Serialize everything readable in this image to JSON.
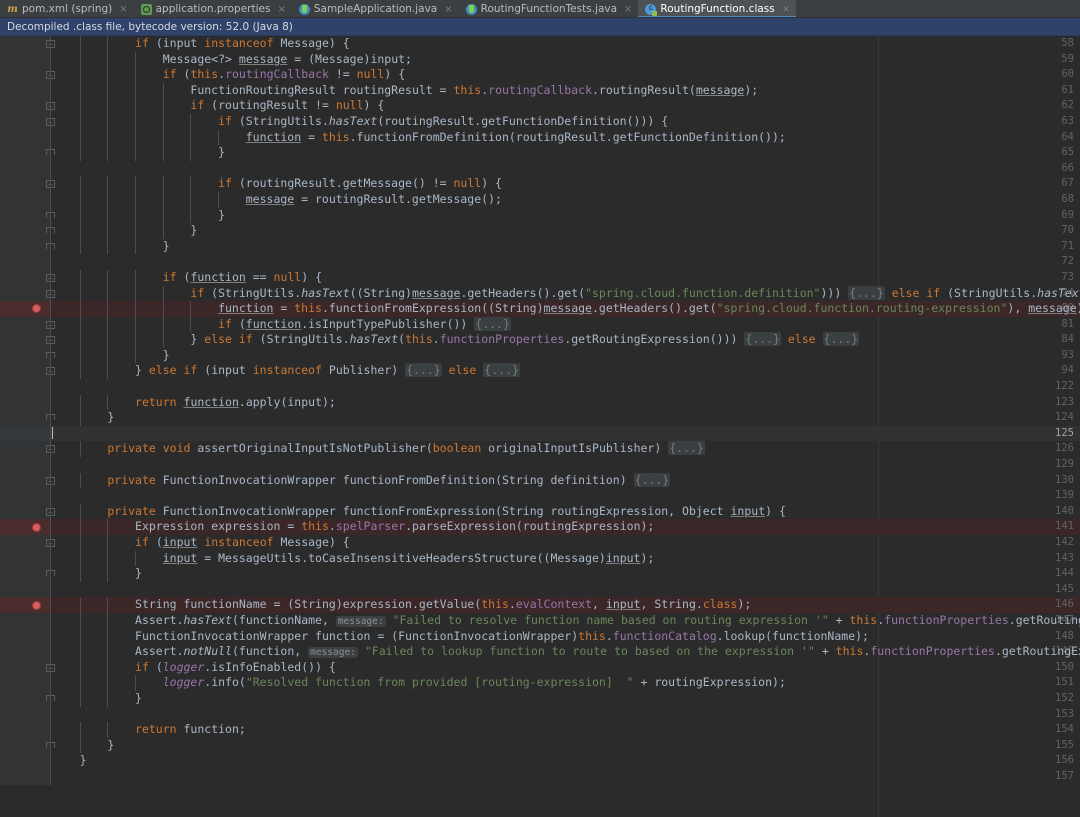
{
  "tabs": [
    {
      "label": "pom.xml (spring)",
      "icon": "maven-icon",
      "active": false,
      "close": "×"
    },
    {
      "label": "application.properties",
      "icon": "properties-icon",
      "active": false,
      "close": "×"
    },
    {
      "label": "SampleApplication.java",
      "icon": "java-class-icon",
      "active": false,
      "close": "×"
    },
    {
      "label": "RoutingFunctionTests.java",
      "icon": "java-class-icon",
      "active": false,
      "close": "×"
    },
    {
      "label": "RoutingFunction.class",
      "icon": "compiled-class-icon",
      "active": true,
      "close": "×"
    }
  ],
  "banner": {
    "text": "Decompiled .class file, bytecode version: 52.0 (Java 8)"
  },
  "colors": {
    "editor_background": "#2b2b2b",
    "gutter_background": "#313335",
    "banner_background": "#2f436a",
    "tab_active_background": "#4e5254",
    "tab_active_underline": "#4a88c7",
    "breakpoint_red": "#db5c5c",
    "breakpoint_line_background": "#3b2727",
    "caret_line_background": "#323232",
    "keyword": "#cc7832",
    "field": "#9876aa",
    "string": "#6a8759",
    "number": "#6897bb",
    "default_text": "#a9b7c6",
    "line_number": "#606366"
  },
  "editor": {
    "file_name": "RoutingFunction.class",
    "right_margin_guide_x": 878,
    "lines": [
      {
        "num": "58",
        "fold": "minus",
        "breakpoint": false,
        "caret": false,
        "indent": 3,
        "clipped_top": true,
        "html": "<span class=\"kw\">if</span> (input <span class=\"kw\">instanceof</span> Message) {"
      },
      {
        "num": "59",
        "fold": "",
        "breakpoint": false,
        "caret": false,
        "indent": 4,
        "html": "Message&lt;?&gt; <span class=\"var\">message</span> = (Message)input;"
      },
      {
        "num": "60",
        "fold": "minus",
        "breakpoint": false,
        "caret": false,
        "indent": 4,
        "html": "<span class=\"kw\">if</span> (<span class=\"kw\">this</span>.<span class=\"fld\">routingCallback</span> != <span class=\"kw\">null</span>) {"
      },
      {
        "num": "61",
        "fold": "",
        "breakpoint": false,
        "caret": false,
        "indent": 5,
        "html": "FunctionRoutingResult routingResult = <span class=\"kw\">this</span>.<span class=\"fld\">routingCallback</span>.routingResult(<span class=\"var\">message</span>);"
      },
      {
        "num": "62",
        "fold": "minus",
        "breakpoint": false,
        "caret": false,
        "indent": 5,
        "html": "<span class=\"kw\">if</span> (routingResult != <span class=\"kw\">null</span>) {"
      },
      {
        "num": "63",
        "fold": "minus",
        "breakpoint": false,
        "caret": false,
        "indent": 6,
        "html": "<span class=\"kw\">if</span> (StringUtils.<span class=\"stat\">hasText</span>(routingResult.getFunctionDefinition())) {"
      },
      {
        "num": "64",
        "fold": "",
        "breakpoint": false,
        "caret": false,
        "indent": 7,
        "html": "<span class=\"var\">function</span> = <span class=\"kw\">this</span>.functionFromDefinition(routingResult.getFunctionDefinition());"
      },
      {
        "num": "65",
        "fold": "endb",
        "breakpoint": false,
        "caret": false,
        "indent": 6,
        "html": "}"
      },
      {
        "num": "66",
        "fold": "",
        "breakpoint": false,
        "caret": false,
        "indent": 0,
        "html": ""
      },
      {
        "num": "67",
        "fold": "minus",
        "breakpoint": false,
        "caret": false,
        "indent": 6,
        "html": "<span class=\"kw\">if</span> (routingResult.getMessage() != <span class=\"kw\">null</span>) {"
      },
      {
        "num": "68",
        "fold": "",
        "breakpoint": false,
        "caret": false,
        "indent": 7,
        "html": "<span class=\"var\">message</span> = routingResult.getMessage();"
      },
      {
        "num": "69",
        "fold": "endb",
        "breakpoint": false,
        "caret": false,
        "indent": 6,
        "html": "}"
      },
      {
        "num": "70",
        "fold": "endb",
        "breakpoint": false,
        "caret": false,
        "indent": 5,
        "html": "}"
      },
      {
        "num": "71",
        "fold": "endb",
        "breakpoint": false,
        "caret": false,
        "indent": 4,
        "html": "}"
      },
      {
        "num": "72",
        "fold": "",
        "breakpoint": false,
        "caret": false,
        "indent": 0,
        "html": ""
      },
      {
        "num": "73",
        "fold": "minus",
        "breakpoint": false,
        "caret": false,
        "indent": 4,
        "html": "<span class=\"kw\">if</span> (<span class=\"var\">function</span> == <span class=\"kw\">null</span>) {"
      },
      {
        "num": "74",
        "fold": "plus",
        "breakpoint": false,
        "caret": false,
        "indent": 5,
        "html": "<span class=\"kw\">if</span> (StringUtils.<span class=\"stat\">hasText</span>((String)<span class=\"var\">message</span>.getHeaders().get(<span class=\"str\">\"spring.cloud.function.definition\"</span>))) <span class=\"fold-ph\">{...}</span> <span class=\"kw\">else if</span> (StringUtils.<span class=\"stat\">hasText</span>((St"
      },
      {
        "num": "80",
        "fold": "",
        "breakpoint": true,
        "caret": false,
        "indent": 6,
        "html": "<span class=\"var\">function</span> = <span class=\"kw\">this</span>.functionFromExpression((String)<span class=\"var\">message</span>.getHeaders().get(<span class=\"str\">\"spring.cloud.function.routing-expression\"</span>), <span class=\"var\">message</span>);"
      },
      {
        "num": "81",
        "fold": "plus",
        "breakpoint": false,
        "caret": false,
        "indent": 6,
        "html": "<span class=\"kw\">if</span> (<span class=\"var\">function</span>.isInputTypePublisher()) <span class=\"fold-ph\">{...}</span>"
      },
      {
        "num": "84",
        "fold": "plus",
        "breakpoint": false,
        "caret": false,
        "indent": 5,
        "html": "} <span class=\"kw\">else if</span> (StringUtils.<span class=\"stat\">hasText</span>(<span class=\"kw\">this</span>.<span class=\"fld\">functionProperties</span>.getRoutingExpression())) <span class=\"fold-ph\">{...}</span> <span class=\"kw\">else</span> <span class=\"fold-ph\">{...}</span>"
      },
      {
        "num": "93",
        "fold": "endb",
        "breakpoint": false,
        "caret": false,
        "indent": 4,
        "html": "}"
      },
      {
        "num": "94",
        "fold": "plus",
        "breakpoint": false,
        "caret": false,
        "indent": 3,
        "html": "} <span class=\"kw\">else if</span> (input <span class=\"kw\">instanceof</span> Publisher) <span class=\"fold-ph\">{...}</span> <span class=\"kw\">else</span> <span class=\"fold-ph\">{...}</span>"
      },
      {
        "num": "122",
        "fold": "",
        "breakpoint": false,
        "caret": false,
        "indent": 0,
        "html": ""
      },
      {
        "num": "123",
        "fold": "",
        "breakpoint": false,
        "caret": false,
        "indent": 3,
        "html": "<span class=\"kw\">return</span> <span class=\"var\">function</span>.apply(input);"
      },
      {
        "num": "124",
        "fold": "endb",
        "breakpoint": false,
        "caret": false,
        "indent": 2,
        "html": "}"
      },
      {
        "num": "125",
        "fold": "",
        "breakpoint": false,
        "caret": true,
        "indent": 0,
        "html": "<span class=\"caretbar\"></span>"
      },
      {
        "num": "126",
        "fold": "plus",
        "breakpoint": false,
        "caret": false,
        "indent": 2,
        "html": "<span class=\"kw\">private void</span> assertOriginalInputIsNotPublisher(<span class=\"kw\">boolean</span> originalInputIsPublisher) <span class=\"fold-ph\">{...}</span>"
      },
      {
        "num": "129",
        "fold": "",
        "breakpoint": false,
        "caret": false,
        "indent": 0,
        "html": ""
      },
      {
        "num": "130",
        "fold": "plus",
        "breakpoint": false,
        "caret": false,
        "indent": 2,
        "html": "<span class=\"kw\">private</span> FunctionInvocationWrapper functionFromDefinition(String definition) <span class=\"fold-ph\">{...}</span>"
      },
      {
        "num": "139",
        "fold": "",
        "breakpoint": false,
        "caret": false,
        "indent": 0,
        "html": ""
      },
      {
        "num": "140",
        "fold": "minus",
        "breakpoint": false,
        "caret": false,
        "indent": 2,
        "html": "<span class=\"kw\">private</span> FunctionInvocationWrapper functionFromExpression(String routingExpression, Object <span class=\"var\">input</span>) {"
      },
      {
        "num": "141",
        "fold": "",
        "breakpoint": true,
        "caret": false,
        "indent": 3,
        "html": "Expression expression = <span class=\"kw\">this</span>.<span class=\"fld\">spelParser</span>.parseExpression(routingExpression);"
      },
      {
        "num": "142",
        "fold": "minus",
        "breakpoint": false,
        "caret": false,
        "indent": 3,
        "html": "<span class=\"kw\">if</span> (<span class=\"var\">input</span> <span class=\"kw\">instanceof</span> Message) {"
      },
      {
        "num": "143",
        "fold": "",
        "breakpoint": false,
        "caret": false,
        "indent": 4,
        "html": "<span class=\"var\">input</span> = MessageUtils.toCaseInsensitiveHeadersStructure((Message)<span class=\"var\">input</span>);"
      },
      {
        "num": "144",
        "fold": "endb",
        "breakpoint": false,
        "caret": false,
        "indent": 3,
        "html": "}"
      },
      {
        "num": "145",
        "fold": "",
        "breakpoint": false,
        "caret": false,
        "indent": 0,
        "html": ""
      },
      {
        "num": "146",
        "fold": "",
        "breakpoint": true,
        "caret": false,
        "indent": 3,
        "html": "String functionName = (String)expression.getValue(<span class=\"kw\">this</span>.<span class=\"fld\">evalContext</span>, <span class=\"var\">input</span>, String.<span class=\"kw\">class</span>);"
      },
      {
        "num": "147",
        "fold": "",
        "breakpoint": false,
        "caret": false,
        "indent": 3,
        "html": "Assert.<span class=\"stat\">hasText</span>(functionName, <span class=\"hint\">message:</span> <span class=\"str\">\"Failed to resolve function name based on routing expression '\"</span> + <span class=\"kw\">this</span>.<span class=\"fld\">functionProperties</span>.getRoutingExpre"
      },
      {
        "num": "148",
        "fold": "",
        "breakpoint": false,
        "caret": false,
        "indent": 3,
        "html": "FunctionInvocationWrapper function = (FunctionInvocationWrapper)<span class=\"kw\">this</span>.<span class=\"fld\">functionCatalog</span>.lookup(functionName);"
      },
      {
        "num": "149",
        "fold": "",
        "breakpoint": false,
        "caret": false,
        "indent": 3,
        "html": "Assert.<span class=\"stat\">notNull</span>(function, <span class=\"hint\">message:</span> <span class=\"str\">\"Failed to lookup function to route to based on the expression '\"</span> + <span class=\"kw\">this</span>.<span class=\"fld\">functionProperties</span>.getRoutingExpress"
      },
      {
        "num": "150",
        "fold": "minus",
        "breakpoint": false,
        "caret": false,
        "indent": 3,
        "html": "<span class=\"kw\">if</span> (<span class=\"stat fld\">logger</span>.isInfoEnabled()) {"
      },
      {
        "num": "151",
        "fold": "",
        "breakpoint": false,
        "caret": false,
        "indent": 4,
        "html": "<span class=\"stat fld\">logger</span>.info(<span class=\"str\">\"Resolved function from provided [routing-expression]  \"</span> + routingExpression);"
      },
      {
        "num": "152",
        "fold": "endb",
        "breakpoint": false,
        "caret": false,
        "indent": 3,
        "html": "}"
      },
      {
        "num": "153",
        "fold": "",
        "breakpoint": false,
        "caret": false,
        "indent": 0,
        "html": ""
      },
      {
        "num": "154",
        "fold": "",
        "breakpoint": false,
        "caret": false,
        "indent": 3,
        "html": "<span class=\"kw\">return</span> function;"
      },
      {
        "num": "155",
        "fold": "endb",
        "breakpoint": false,
        "caret": false,
        "indent": 2,
        "html": "}"
      },
      {
        "num": "156",
        "fold": "",
        "breakpoint": false,
        "caret": false,
        "indent": 1,
        "html": "}"
      },
      {
        "num": "157",
        "fold": "",
        "breakpoint": false,
        "caret": false,
        "indent": 0,
        "html": ""
      }
    ]
  }
}
